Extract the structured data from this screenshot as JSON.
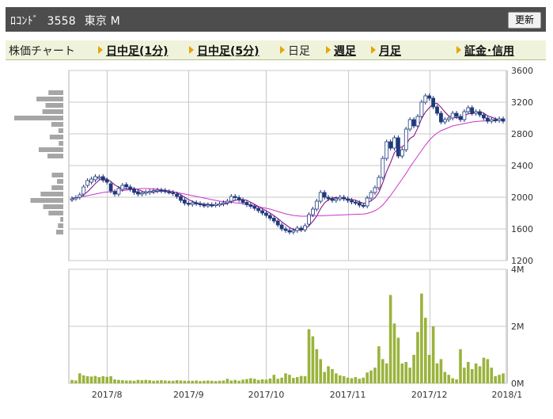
{
  "header": {
    "ticker_name": "ﾛｺﾝﾄﾞ",
    "code": "3558",
    "market": "東京 M",
    "refresh_label": "更新"
  },
  "nav": {
    "label": "株価チャート",
    "items": [
      {
        "label": "日中足(1分)",
        "link": true
      },
      {
        "label": "日中足(5分)",
        "link": true
      },
      {
        "label": "日足",
        "link": false
      },
      {
        "label": "週足",
        "link": true
      },
      {
        "label": "月足",
        "link": true
      },
      {
        "label": "証金･信用",
        "link": true
      }
    ]
  },
  "colors": {
    "up": "#ffffff",
    "down": "#1f3a7a",
    "ma_short": "#800080",
    "ma_long": "#cc33cc",
    "volume_bar": "#9ab33c",
    "price_profile": "#a6a6a6",
    "grid": "#c8c8c8"
  },
  "chart_data": {
    "type": "candlestick",
    "price_axis": {
      "min": 1200,
      "max": 3600,
      "ticks": [
        3600,
        3200,
        2800,
        2400,
        2000,
        1600,
        1200
      ],
      "labels": [
        "3600",
        "3200",
        "2800",
        "2400",
        "2000",
        "1600",
        "1200"
      ]
    },
    "volume_axis": {
      "min": 0,
      "max": 4000000,
      "ticks": [
        4000000,
        2000000,
        0
      ],
      "labels": [
        "4M",
        "2M",
        "0M"
      ]
    },
    "x_labels": [
      "2017/8",
      "2017/9",
      "2017/10",
      "2017/11",
      "2017/12",
      "2018/1"
    ],
    "x_label_index": [
      9,
      30,
      50,
      71,
      92,
      112
    ],
    "close": [
      1980,
      1995,
      2030,
      2130,
      2210,
      2230,
      2260,
      2255,
      2215,
      2190,
      2080,
      2040,
      2110,
      2150,
      2130,
      2100,
      2060,
      2040,
      2055,
      2065,
      2075,
      2085,
      2090,
      2080,
      2075,
      2065,
      2045,
      2010,
      1960,
      1925,
      1915,
      1930,
      1920,
      1905,
      1895,
      1905,
      1900,
      1910,
      1915,
      1930,
      1950,
      2010,
      1995,
      1965,
      1935,
      1905,
      1885,
      1860,
      1830,
      1800,
      1770,
      1735,
      1700,
      1650,
      1600,
      1580,
      1560,
      1580,
      1610,
      1590,
      1640,
      1780,
      1850,
      1950,
      2060,
      2000,
      1980,
      1960,
      1980,
      2000,
      1980,
      1960,
      1940,
      1930,
      1900,
      1890,
      1990,
      2060,
      2120,
      2250,
      2490,
      2700,
      2620,
      2750,
      2520,
      2600,
      2860,
      2980,
      2900,
      3020,
      3200,
      3280,
      3250,
      3140,
      3060,
      2950,
      2980,
      3000,
      3060,
      3020,
      2980,
      3080,
      3130,
      3060,
      3080,
      3040,
      3000,
      2960,
      2980,
      2970,
      2990,
      2960
    ],
    "open": [
      1970,
      1985,
      2000,
      2040,
      2150,
      2190,
      2220,
      2250,
      2260,
      2220,
      2170,
      2070,
      2040,
      2100,
      2160,
      2130,
      2100,
      2070,
      2040,
      2050,
      2060,
      2070,
      2080,
      2090,
      2085,
      2070,
      2060,
      2040,
      2010,
      1965,
      1925,
      1910,
      1930,
      1920,
      1905,
      1895,
      1905,
      1900,
      1905,
      1915,
      1930,
      1950,
      2010,
      1995,
      1965,
      1935,
      1905,
      1885,
      1860,
      1830,
      1800,
      1770,
      1735,
      1700,
      1650,
      1600,
      1580,
      1560,
      1580,
      1610,
      1590,
      1660,
      1780,
      1850,
      1950,
      2060,
      2000,
      1980,
      1960,
      1980,
      2000,
      1980,
      1960,
      1940,
      1930,
      1900,
      1890,
      1990,
      2060,
      2120,
      2250,
      2490,
      2700,
      2620,
      2750,
      2520,
      2600,
      2860,
      2980,
      2900,
      3020,
      3200,
      3280,
      3250,
      3140,
      3060,
      2950,
      2980,
      3000,
      3060,
      3020,
      2980,
      3080,
      3130,
      3060,
      3080,
      3040,
      3000,
      2960,
      2980,
      2970,
      2990
    ],
    "ma25": [
      1990,
      1990,
      2000,
      2010,
      2020,
      2030,
      2040,
      2050,
      2060,
      2065,
      2070,
      2075,
      2080,
      2085,
      2090,
      2095,
      2100,
      2105,
      2110,
      2110,
      2108,
      2105,
      2100,
      2095,
      2090,
      2080,
      2070,
      2060,
      2050,
      2040,
      2030,
      2020,
      2010,
      2000,
      1990,
      1980,
      1970,
      1960,
      1950,
      1945,
      1940,
      1935,
      1930,
      1925,
      1920,
      1910,
      1900,
      1890,
      1880,
      1870,
      1860,
      1850,
      1835,
      1820,
      1805,
      1790,
      1780,
      1770,
      1765,
      1760,
      1760,
      1762,
      1764,
      1765,
      1766,
      1768,
      1770,
      1772,
      1774,
      1776,
      1778,
      1780,
      1782,
      1784,
      1786,
      1788,
      1795,
      1810,
      1830,
      1860,
      1900,
      1960,
      2020,
      2090,
      2160,
      2230,
      2300,
      2380,
      2450,
      2520,
      2590,
      2660,
      2720,
      2770,
      2810,
      2840,
      2860,
      2880,
      2900,
      2910,
      2920,
      2930,
      2940,
      2950,
      2955,
      2960,
      2962,
      2964,
      2966,
      2968,
      2970,
      2972
    ],
    "volume": [
      120000,
      100000,
      350000,
      280000,
      250000,
      240000,
      260000,
      220000,
      250000,
      230000,
      250000,
      140000,
      120000,
      110000,
      100000,
      100000,
      90000,
      120000,
      110000,
      120000,
      110000,
      90000,
      100000,
      110000,
      100000,
      90000,
      90000,
      110000,
      100000,
      90000,
      90000,
      90000,
      100000,
      80000,
      90000,
      100000,
      90000,
      80000,
      90000,
      100000,
      160000,
      100000,
      120000,
      90000,
      130000,
      150000,
      180000,
      160000,
      120000,
      140000,
      130000,
      170000,
      300000,
      160000,
      200000,
      350000,
      300000,
      190000,
      220000,
      260000,
      250000,
      1900000,
      1650000,
      1200000,
      850000,
      400000,
      600000,
      500000,
      350000,
      280000,
      250000,
      200000,
      180000,
      220000,
      160000,
      200000,
      380000,
      450000,
      550000,
      1300000,
      850000,
      700000,
      3100000,
      2100000,
      1600000,
      700000,
      750000,
      550000,
      1000000,
      1800000,
      3150000,
      2300000,
      1000000,
      2000000,
      700000,
      850000,
      400000,
      300000,
      180000,
      140000,
      1200000,
      550000,
      750000,
      500000,
      700000,
      600000,
      900000,
      850000,
      550000,
      250000,
      300000,
      350000
    ]
  }
}
